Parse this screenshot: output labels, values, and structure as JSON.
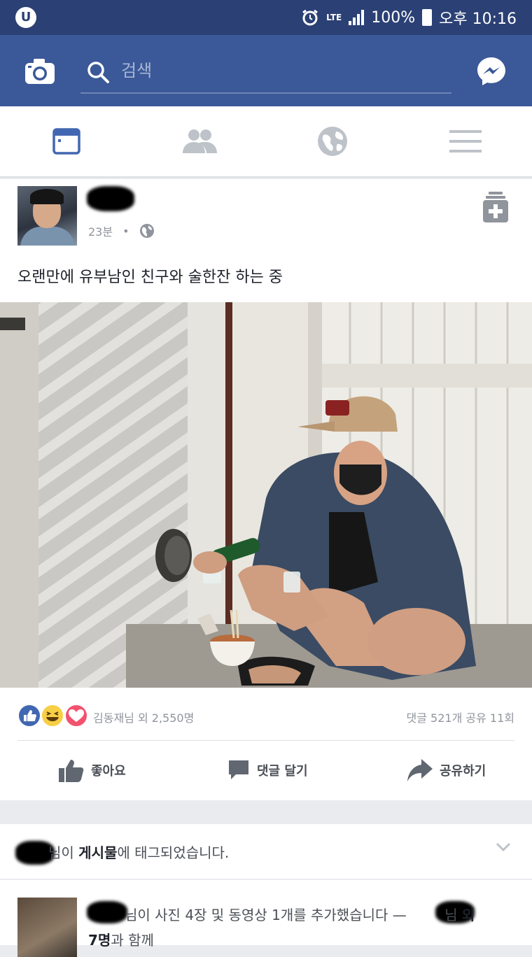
{
  "status": {
    "carrier_icon": "uplus-logo",
    "network": "LTE",
    "battery": "100%",
    "time": "오후 10:16"
  },
  "search": {
    "placeholder": "검색"
  },
  "nav": {
    "tabs": [
      {
        "name": "news-feed",
        "icon": "feed-icon",
        "active": true
      },
      {
        "name": "friends",
        "icon": "friends-icon",
        "active": false
      },
      {
        "name": "notifications",
        "icon": "globe-icon",
        "active": false
      },
      {
        "name": "menu",
        "icon": "menu-icon",
        "active": false
      }
    ]
  },
  "post": {
    "time": "23분",
    "text": "오랜만에 유부남인 친구와 술한잔 하는 중",
    "reactions": [
      "like",
      "haha",
      "love"
    ],
    "liked_by": "김동재님 외 2,550명",
    "comments_shares": "댓글 521개 공유 11회",
    "actions": {
      "like": "좋아요",
      "comment": "댓글 달기",
      "share": "공유하기"
    }
  },
  "notification": {
    "prefix": "님이",
    "bold": "게시물",
    "suffix": "에 태그되었습니다."
  },
  "post2": {
    "line1": "님이 사진 4장 및 동영상 1개를 추가했습니다 —",
    "line1_tail": "님",
    "line1_bold": "외",
    "line2_bold": "7명",
    "line2": "과 함께"
  },
  "colors": {
    "status_bar": "#2b4074",
    "header": "#3b5998",
    "accent": "#4267b2"
  }
}
